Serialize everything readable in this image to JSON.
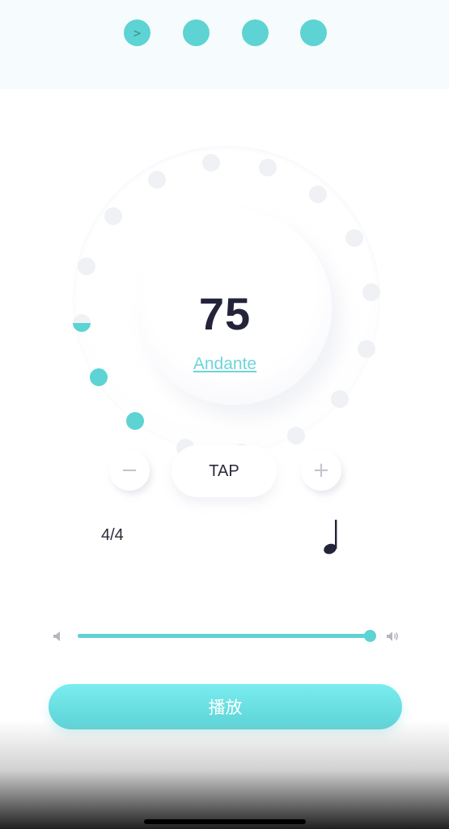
{
  "beats": {
    "indicators": [
      {
        "label": ">",
        "accent": true
      },
      {
        "label": "",
        "accent": false
      },
      {
        "label": "",
        "accent": false
      },
      {
        "label": "",
        "accent": false
      }
    ]
  },
  "tempo": {
    "bpm": "75",
    "name": "Andante",
    "dial_total_ticks": 16,
    "dial_active_ticks": 2
  },
  "controls": {
    "decrease_label": "−",
    "tap_label": "TAP",
    "increase_label": "+"
  },
  "meter": {
    "time_signature": "4/4",
    "note_value": "quarter-note-icon"
  },
  "volume": {
    "level": 1.0,
    "low_icon": "speaker-low-icon",
    "high_icon": "speaker-high-icon"
  },
  "play": {
    "label": "播放"
  },
  "colors": {
    "accent": "#5dd3d3",
    "inactive_tick": "#f0f1f5",
    "text_dark": "#23233a",
    "tempo_name": "#6fd5d8"
  }
}
